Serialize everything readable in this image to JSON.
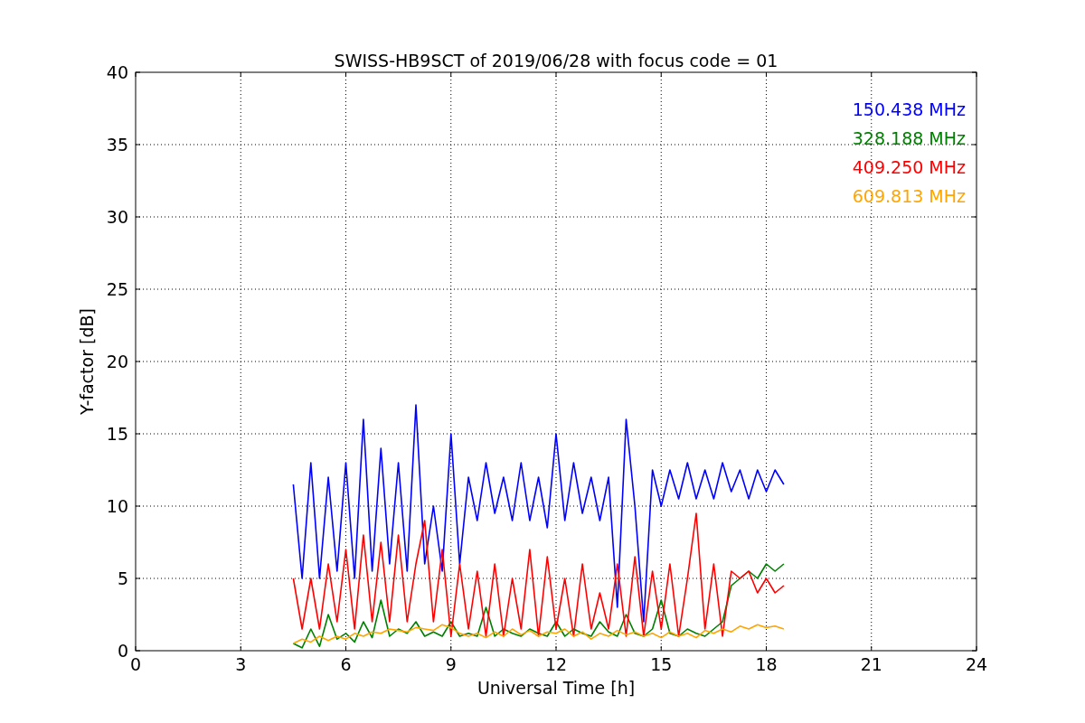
{
  "chart_data": {
    "type": "line",
    "title": "SWISS-HB9SCT of 2019/06/28 with focus code = 01",
    "xlabel": "Universal Time [h]",
    "ylabel": "Y-factor [dB]",
    "x": [
      4.5,
      4.75,
      5,
      5.25,
      5.5,
      5.75,
      6,
      6.25,
      6.5,
      6.75,
      7,
      7.25,
      7.5,
      7.75,
      8,
      8.25,
      8.5,
      8.75,
      9,
      9.25,
      9.5,
      9.75,
      10,
      10.25,
      10.5,
      10.75,
      11,
      11.25,
      11.5,
      11.75,
      12,
      12.25,
      12.5,
      12.75,
      13,
      13.25,
      13.5,
      13.75,
      14,
      14.25,
      14.5,
      14.75,
      15,
      15.25,
      15.5,
      15.75,
      16,
      16.25,
      16.5,
      16.75,
      17,
      17.25,
      17.5,
      17.75,
      18,
      18.25,
      18.5
    ],
    "series": [
      {
        "name": "150.438 MHz",
        "color": "#0000ff",
        "values": [
          11.5,
          5,
          13,
          5,
          12,
          5.5,
          13,
          5,
          16,
          5.5,
          14,
          6,
          13,
          5.5,
          17,
          6,
          10,
          5.5,
          15,
          6,
          12,
          9,
          13,
          9.5,
          12,
          9,
          13,
          9,
          12,
          8.5,
          15,
          9,
          13,
          9.5,
          12,
          9,
          12,
          3,
          16,
          10,
          2,
          12.5,
          10,
          12.5,
          10.5,
          13,
          10.5,
          12.5,
          10.5,
          13,
          11,
          12.5,
          10.5,
          12.5,
          11,
          12.5,
          11.5
        ]
      },
      {
        "name": "328.188 MHz",
        "color": "#008000",
        "values": [
          0.5,
          0.2,
          1.5,
          0.3,
          2.5,
          0.8,
          1.2,
          0.6,
          2,
          0.9,
          3.5,
          1,
          1.5,
          1.2,
          2,
          1,
          1.3,
          1,
          2,
          1,
          1.2,
          1,
          3,
          1,
          1.5,
          1.2,
          1,
          1.5,
          1.2,
          1,
          2,
          1,
          1.5,
          1.2,
          1,
          2,
          1.3,
          1,
          2.5,
          1.2,
          1,
          1.5,
          3.5,
          1.2,
          1,
          1.5,
          1.2,
          1,
          1.5,
          2,
          4.5,
          5,
          5.5,
          5,
          6,
          5.5,
          6
        ]
      },
      {
        "name": "409.250 MHz",
        "color": "#ff0000",
        "values": [
          5,
          1.5,
          5,
          1.5,
          6,
          2,
          7,
          1.5,
          8,
          2,
          7.5,
          2,
          8,
          2,
          6,
          9,
          2,
          7,
          1,
          6,
          1.5,
          5.5,
          1,
          6,
          1,
          5,
          1.5,
          7,
          1,
          6.5,
          1.5,
          5,
          1,
          6,
          1.5,
          4,
          1.5,
          6,
          1,
          6.5,
          1,
          5.5,
          1.5,
          6,
          1,
          5,
          9.5,
          1.5,
          6,
          1,
          5.5,
          5,
          5.5,
          4,
          5,
          4,
          4.5
        ]
      },
      {
        "name": "609.813 MHz",
        "color": "#ffa500",
        "values": [
          0.5,
          0.8,
          0.6,
          1,
          0.7,
          1,
          0.8,
          1.2,
          1,
          1.3,
          1.2,
          1.5,
          1.4,
          1.3,
          1.6,
          1.5,
          1.4,
          1.8,
          1.6,
          1.2,
          1,
          1.2,
          0.9,
          1.3,
          1,
          1.5,
          1.1,
          1.4,
          1,
          1.3,
          1.2,
          1.5,
          1,
          1.3,
          0.8,
          1.2,
          1,
          1.4,
          1.1,
          1.3,
          1,
          1.2,
          0.9,
          1.3,
          1,
          1.2,
          0.9,
          1.4,
          1.2,
          1.5,
          1.3,
          1.7,
          1.5,
          1.8,
          1.6,
          1.7,
          1.5
        ]
      }
    ],
    "xlim": [
      0,
      24
    ],
    "ylim": [
      0,
      40
    ],
    "grid": true,
    "xticks": [
      0,
      3,
      6,
      9,
      12,
      15,
      18,
      21,
      24
    ],
    "yticks": [
      0,
      5,
      10,
      15,
      20,
      25,
      30,
      35,
      40
    ]
  }
}
